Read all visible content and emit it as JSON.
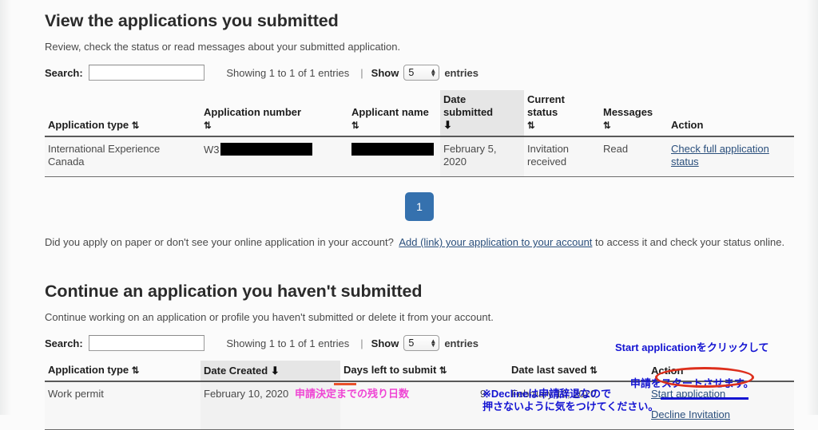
{
  "submitted_section": {
    "title": "View the applications you submitted",
    "description": "Review, check the status or read messages about your submitted application.",
    "controls": {
      "search_label": "Search:",
      "search_value": "",
      "search_placeholder": "",
      "showing_text": "Showing 1 to 1 of 1 entries",
      "separator": "|",
      "show_label": "Show",
      "page_size": "5",
      "entries_label": "entries"
    },
    "columns": [
      {
        "label": "Application type",
        "sort": "both"
      },
      {
        "label": "Application number",
        "sort": "both"
      },
      {
        "label": "Applicant name",
        "sort": "both"
      },
      {
        "label": "Date submitted",
        "sort": "desc"
      },
      {
        "label": "Current status",
        "sort": "both"
      },
      {
        "label": "Messages",
        "sort": "both"
      },
      {
        "label": "Action",
        "sort": "none"
      }
    ],
    "rows": [
      {
        "application_type": "International Experience Canada",
        "application_number_prefix": "W3",
        "application_number_redacted": true,
        "applicant_name_redacted": true,
        "date_submitted": "February 5, 2020",
        "current_status": "Invitation received",
        "messages": "Read",
        "action_label": "Check full application status"
      }
    ],
    "pagination": {
      "current_page": "1"
    }
  },
  "paper_note": {
    "text_before": "Did you apply on paper or don't see your online application in your account?",
    "link_text": "Add (link) your application to your account",
    "text_after": "to access it and check your status online."
  },
  "continue_section": {
    "title": "Continue an application you haven't submitted",
    "description": "Continue working on an application or profile you haven't submitted or delete it from your account.",
    "controls": {
      "search_label": "Search:",
      "search_value": "",
      "search_placeholder": "",
      "showing_text": "Showing 1 to 1 of 1 entries",
      "separator": "|",
      "show_label": "Show",
      "page_size": "5",
      "entries_label": "entries"
    },
    "columns": [
      {
        "label": "Application type",
        "sort": "both"
      },
      {
        "label": "Date Created",
        "sort": "desc"
      },
      {
        "label": "Days left to submit",
        "sort": "both"
      },
      {
        "label": "Date last saved",
        "sort": "both"
      },
      {
        "label": "Action",
        "sort": "none"
      }
    ],
    "rows": [
      {
        "application_type": "Work permit",
        "date_created": "February 10, 2020",
        "days_left": "9",
        "date_last_saved": "February 10, 2020",
        "action_primary": "Start application",
        "action_secondary": "Decline Invitation"
      }
    ]
  },
  "annotations": {
    "start_application_note_line1": "Start applicationをクリックして",
    "start_application_note_line2": "申請をスタートさせます。",
    "days_left_note": "申請決定までの残り日数",
    "decline_note_line1": "※Declineは申請辞退なので",
    "decline_note_line2": "押さないように気をつけてください。",
    "colors": {
      "blue": "#1414d2",
      "pink": "#ef45d4",
      "red": "#dd2f1c",
      "orange_underline": "#e8502a"
    }
  },
  "icons": {
    "sort_both": "⇅",
    "sort_desc": "⬇",
    "stepper_up": "▲",
    "stepper_down": "▼"
  },
  "theme": {
    "pagination_active_bg": "#3571ae",
    "link_color": "#2a4f7c",
    "page_bg": "#fbfbfb"
  }
}
